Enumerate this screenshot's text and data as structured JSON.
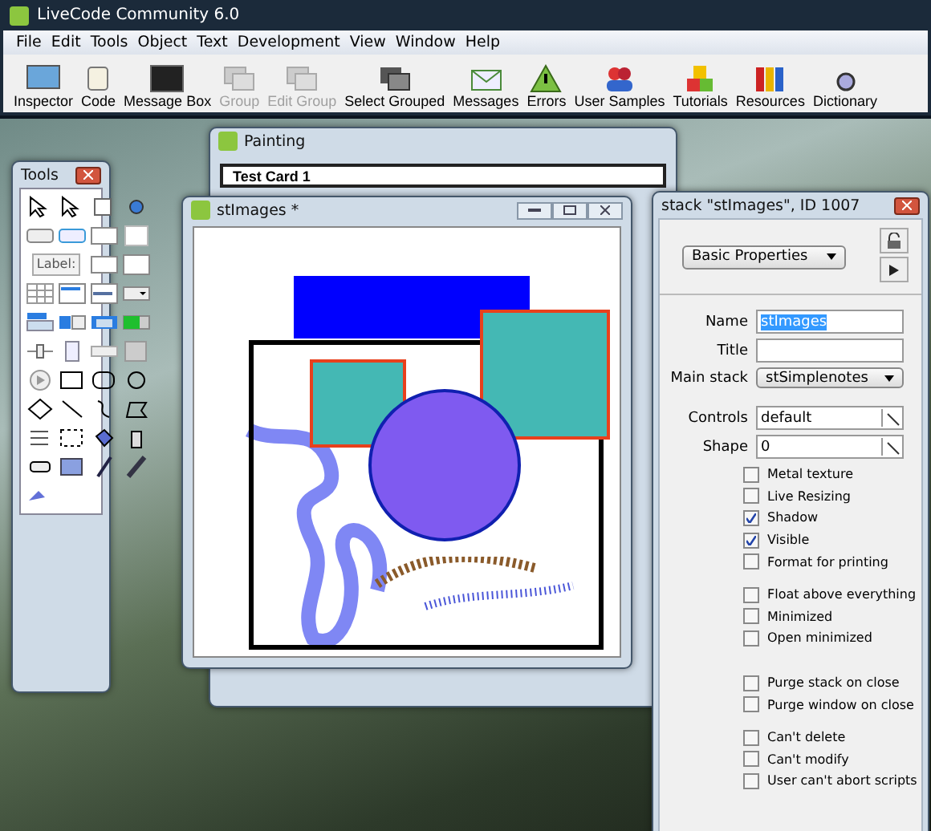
{
  "app": {
    "title": "LiveCode Community 6.0"
  },
  "menu": [
    "File",
    "Edit",
    "Tools",
    "Object",
    "Text",
    "Development",
    "View",
    "Window",
    "Help"
  ],
  "toolbar": [
    {
      "label": "Inspector",
      "kind": "inspector",
      "disabled": false
    },
    {
      "label": "Code",
      "kind": "code",
      "disabled": false
    },
    {
      "label": "Message Box",
      "kind": "msgbox",
      "disabled": false
    },
    {
      "label": "Group",
      "kind": "group",
      "disabled": true
    },
    {
      "label": "Edit Group",
      "kind": "editgroup",
      "disabled": true
    },
    {
      "label": "Select Grouped",
      "kind": "selectgrouped",
      "disabled": false
    },
    {
      "label": "Messages",
      "kind": "messages",
      "disabled": false
    },
    {
      "label": "Errors",
      "kind": "errors",
      "disabled": false
    },
    {
      "label": "User Samples",
      "kind": "samples",
      "disabled": false
    },
    {
      "label": "Tutorials",
      "kind": "tutorials",
      "disabled": false
    },
    {
      "label": "Resources",
      "kind": "resources",
      "disabled": false
    },
    {
      "label": "Dictionary",
      "kind": "dictionary",
      "disabled": false
    }
  ],
  "tools": {
    "title": "Tools",
    "label_tool": "Label:"
  },
  "painting": {
    "title": "Painting",
    "card_title": "Test Card 1"
  },
  "stack_window": {
    "title": "stImages *"
  },
  "inspector": {
    "title": "stack \"stImages\", ID 1007",
    "section": "Basic Properties",
    "fields": [
      {
        "label": "Name",
        "value": "stImages",
        "kind": "text",
        "highlighted": true
      },
      {
        "label": "Title",
        "kind": "text"
      },
      {
        "label": "Main stack",
        "value": "stSimplenotes",
        "kind": "select"
      },
      {
        "label": "Controls",
        "value": "default",
        "kind": "picker"
      },
      {
        "label": "Shape",
        "value": "0",
        "kind": "picker"
      }
    ],
    "groups": [
      [
        {
          "label": "Metal texture",
          "checked": false
        },
        {
          "label": "Live Resizing",
          "checked": false
        },
        {
          "label": "Shadow",
          "checked": true
        },
        {
          "label": "Visible",
          "checked": true
        },
        {
          "label": "Format for printing",
          "checked": false
        }
      ],
      [
        {
          "label": "Float above everything",
          "checked": false
        },
        {
          "label": "Minimized",
          "checked": false
        },
        {
          "label": "Open minimized",
          "checked": false
        }
      ],
      [
        {
          "label": "Purge stack on close",
          "checked": false
        },
        {
          "label": "Purge window on close",
          "checked": false
        }
      ],
      [
        {
          "label": "Can't delete",
          "checked": false
        },
        {
          "label": "Can't modify",
          "checked": false
        },
        {
          "label": "User can't abort scripts",
          "checked": false
        }
      ]
    ]
  }
}
